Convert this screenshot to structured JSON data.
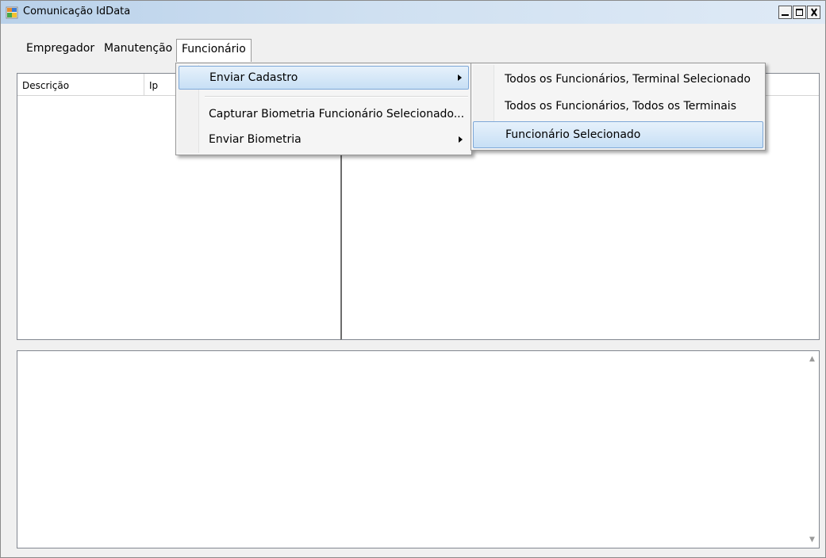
{
  "window": {
    "title": "Comunicação IdData",
    "icon": "app-window-icon",
    "controls": [
      "minimize-icon",
      "maximize-icon",
      "close-icon"
    ]
  },
  "menubar": {
    "items": [
      {
        "label": "Empregador"
      },
      {
        "label": "Manutenção"
      },
      {
        "label": "Funcionário"
      }
    ]
  },
  "listview": {
    "columns": [
      "Descrição",
      "Ip"
    ]
  },
  "dropdown": {
    "items": [
      {
        "label": "Enviar Cadastro",
        "submenu": true,
        "highlighted": true
      },
      {
        "label": "Capturar Biometria Funcionário Selecionado...",
        "submenu": false
      },
      {
        "label": "Enviar Biometria",
        "submenu": true
      }
    ]
  },
  "submenu": {
    "items": [
      {
        "label": "Todos os Funcionários, Terminal Selecionado"
      },
      {
        "label": "Todos os Funcionários, Todos os Terminais"
      },
      {
        "label": "Funcionário Selecionado",
        "highlighted": true
      }
    ]
  },
  "colors": {
    "titlebar": "#c4d9ee",
    "highlight_border": "#7ea8d8",
    "highlight_fill": "#d5e8f8"
  }
}
